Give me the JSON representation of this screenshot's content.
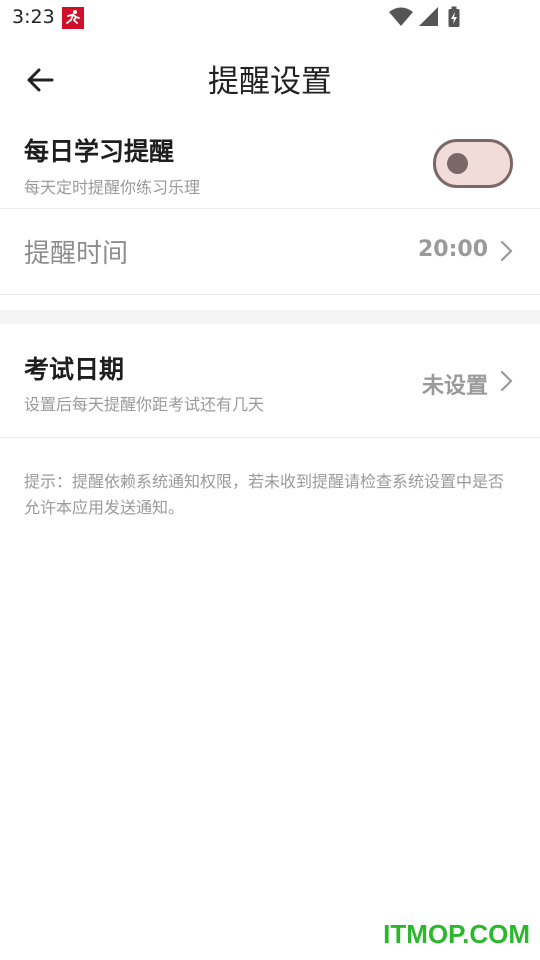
{
  "status_bar": {
    "time": "3:23",
    "icons": [
      "running-app-notification-icon",
      "wifi-icon",
      "cellular-signal-icon",
      "battery-charging-icon"
    ]
  },
  "header": {
    "title": "提醒设置",
    "back_icon": "arrow-left-icon"
  },
  "daily_reminder": {
    "title": "每日学习提醒",
    "subtitle": "每天定时提醒你练习乐理",
    "toggle_on": false
  },
  "reminder_time": {
    "label": "提醒时间",
    "value": "20:00"
  },
  "exam_date": {
    "title": "考试日期",
    "subtitle": "设置后每天提醒你距考试还有几天",
    "value": "未设置"
  },
  "tip": {
    "text": "提示：提醒依赖系统通知权限，若未收到提醒请检查系统设置中是否允许本应用发送通知。"
  },
  "watermark": {
    "text": "ITMOP.COM"
  },
  "colors": {
    "toggle_track": "#f2dcd9",
    "toggle_border": "#7a6868",
    "watermark": "#2cb82c"
  }
}
